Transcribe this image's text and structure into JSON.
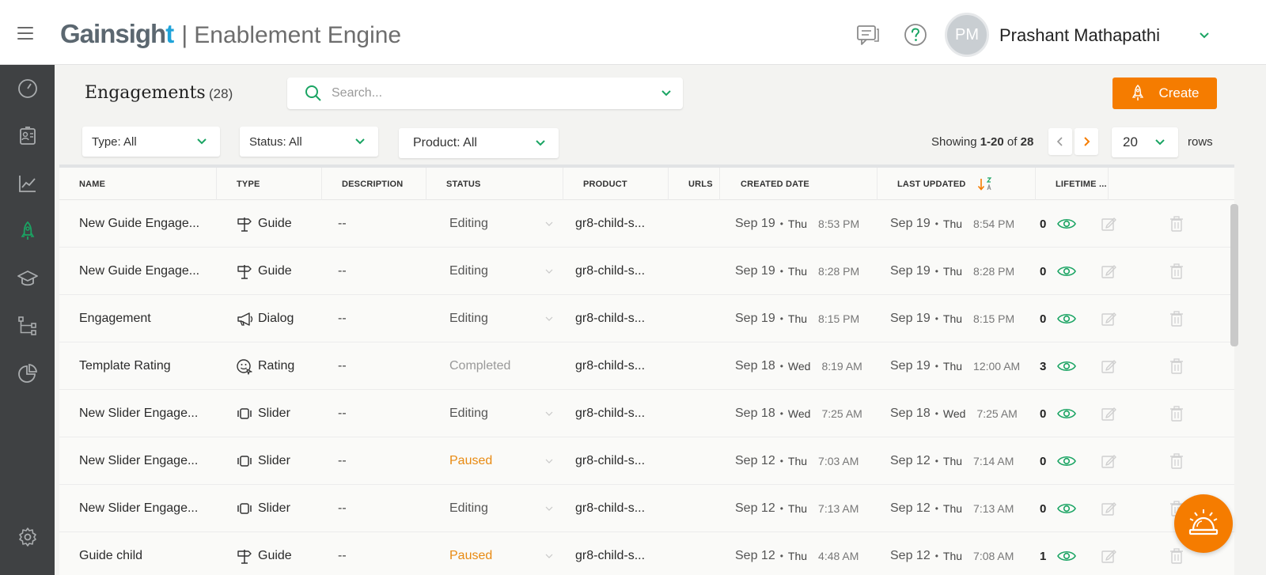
{
  "header": {
    "brand_logo": "Gainsight",
    "brand_separator": "|",
    "app_name": "Enablement Engine",
    "user_initials": "PM",
    "user_name": "Prashant Mathapathi"
  },
  "sidebar": {
    "items": [
      {
        "icon": "dashboard-gauge-icon",
        "active": false
      },
      {
        "icon": "user-profiles-icon",
        "active": false
      },
      {
        "icon": "analytics-chart-icon",
        "active": false
      },
      {
        "icon": "engagements-rocket-icon",
        "active": true
      },
      {
        "icon": "learning-cap-icon",
        "active": false
      },
      {
        "icon": "workflow-tree-icon",
        "active": false
      },
      {
        "icon": "reports-pie-icon",
        "active": false
      },
      {
        "icon": "settings-gear-icon",
        "active": false
      }
    ]
  },
  "page": {
    "title": "Engagements",
    "count": "(28)",
    "search_placeholder": "Search...",
    "create_label": "Create"
  },
  "filters": {
    "type_label": "Type:  All",
    "status_label": "Status:  All",
    "product_label": "Product: All"
  },
  "pagination": {
    "showing_prefix": "Showing ",
    "range": "1-20",
    "of_text": " of ",
    "total": "28",
    "rows_value": "20",
    "rows_label": "rows"
  },
  "table": {
    "columns": [
      "NAME",
      "TYPE",
      "DESCRIPTION",
      "STATUS",
      "PRODUCT",
      "URLS",
      "CREATED DATE",
      "LAST UPDATED",
      "LIFETIME ..."
    ],
    "rows": [
      {
        "name": "New Guide Engage...",
        "type": "Guide",
        "type_icon": "guide-signpost-icon",
        "description": "--",
        "status": "Editing",
        "status_kind": "editing",
        "product": "gr8-child-s...",
        "created_date": "Sep 19",
        "created_dow": "Thu",
        "created_time": "8:53 PM",
        "updated_date": "Sep 19",
        "updated_dow": "Thu",
        "updated_time": "8:54 PM",
        "lifetime": "0"
      },
      {
        "name": "New Guide Engage...",
        "type": "Guide",
        "type_icon": "guide-signpost-icon",
        "description": "--",
        "status": "Editing",
        "status_kind": "editing",
        "product": "gr8-child-s...",
        "created_date": "Sep 19",
        "created_dow": "Thu",
        "created_time": "8:28 PM",
        "updated_date": "Sep 19",
        "updated_dow": "Thu",
        "updated_time": "8:28 PM",
        "lifetime": "0"
      },
      {
        "name": "Engagement",
        "type": "Dialog",
        "type_icon": "dialog-megaphone-icon",
        "description": "--",
        "status": "Editing",
        "status_kind": "editing",
        "product": "gr8-child-s...",
        "created_date": "Sep 19",
        "created_dow": "Thu",
        "created_time": "8:15 PM",
        "updated_date": "Sep 19",
        "updated_dow": "Thu",
        "updated_time": "8:15 PM",
        "lifetime": "0"
      },
      {
        "name": "Template Rating",
        "type": "Rating",
        "type_icon": "rating-face-icon",
        "description": "--",
        "status": "Completed",
        "status_kind": "completed",
        "product": "gr8-child-s...",
        "created_date": "Sep 18",
        "created_dow": "Wed",
        "created_time": "8:19 AM",
        "updated_date": "Sep 19",
        "updated_dow": "Thu",
        "updated_time": "12:00 AM",
        "lifetime": "3"
      },
      {
        "name": "New Slider Engage...",
        "type": "Slider",
        "type_icon": "slider-panel-icon",
        "description": "--",
        "status": "Editing",
        "status_kind": "editing",
        "product": "gr8-child-s...",
        "created_date": "Sep 18",
        "created_dow": "Wed",
        "created_time": "7:25 AM",
        "updated_date": "Sep 18",
        "updated_dow": "Wed",
        "updated_time": "7:25 AM",
        "lifetime": "0"
      },
      {
        "name": "New Slider Engage...",
        "type": "Slider",
        "type_icon": "slider-panel-icon",
        "description": "--",
        "status": "Paused",
        "status_kind": "paused",
        "product": "gr8-child-s...",
        "created_date": "Sep 12",
        "created_dow": "Thu",
        "created_time": "7:03 AM",
        "updated_date": "Sep 12",
        "updated_dow": "Thu",
        "updated_time": "7:14 AM",
        "lifetime": "0"
      },
      {
        "name": "New Slider Engage...",
        "type": "Slider",
        "type_icon": "slider-panel-icon",
        "description": "--",
        "status": "Editing",
        "status_kind": "editing",
        "product": "gr8-child-s...",
        "created_date": "Sep 12",
        "created_dow": "Thu",
        "created_time": "7:13 AM",
        "updated_date": "Sep 12",
        "updated_dow": "Thu",
        "updated_time": "7:13 AM",
        "lifetime": "0"
      },
      {
        "name": "Guide child",
        "type": "Guide",
        "type_icon": "guide-signpost-icon",
        "description": "--",
        "status": "Paused",
        "status_kind": "paused",
        "product": "gr8-child-s...",
        "created_date": "Sep 12",
        "created_dow": "Thu",
        "created_time": "4:48 AM",
        "updated_date": "Sep 12",
        "updated_dow": "Thu",
        "updated_time": "7:08 AM",
        "lifetime": "1"
      }
    ]
  },
  "colors": {
    "accent_orange": "#f57c00",
    "accent_green": "#1aa463",
    "sidebar_bg": "#3f4143",
    "paused": "#e88a12"
  }
}
